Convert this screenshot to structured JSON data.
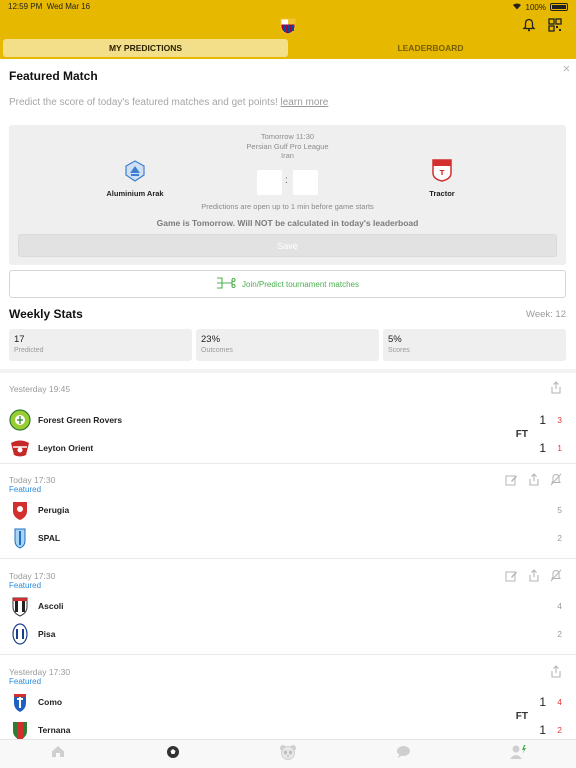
{
  "status": {
    "time": "12:59 PM",
    "date": "Wed Mar 16",
    "battery": "100%"
  },
  "tabs": [
    {
      "label": "MY PREDICTIONS"
    },
    {
      "label": "LEADERBOARD"
    }
  ],
  "featured": {
    "title": "Featured Match",
    "intro": "Predict the score of today's featured matches and get points!",
    "learn_more": "learn more",
    "kickoff": "Tomorrow 11:30",
    "league": "Persian Gulf Pro League",
    "country": "Iran",
    "home": "Aluminium Arak",
    "away": "Tractor",
    "colon": ":",
    "note1": "Predictions are open up to 1 min before game starts",
    "note2": "Game is Tomorrow. Will NOT be calculated in today's leaderboad",
    "save": "Save",
    "join": "Join/Predict tournament matches"
  },
  "weekly": {
    "title": "Weekly Stats",
    "week": "Week: 12",
    "stats": [
      {
        "value": "17",
        "label": "Predicted"
      },
      {
        "value": "23%",
        "label": "Outcomes"
      },
      {
        "value": "5%",
        "label": "Scores"
      }
    ]
  },
  "matches": [
    {
      "time": "Yesterday 19:45",
      "featured": "",
      "status": "FT",
      "home": {
        "name": "Forest Green Rovers",
        "score": "1",
        "pred": "3"
      },
      "away": {
        "name": "Leyton Orient",
        "score": "1",
        "pred": "1"
      }
    },
    {
      "time": "Today 17:30",
      "featured": "Featured",
      "status": "",
      "home": {
        "name": "Perugia",
        "score": "",
        "pred": "5"
      },
      "away": {
        "name": "SPAL",
        "score": "",
        "pred": "2"
      }
    },
    {
      "time": "Today 17:30",
      "featured": "Featured",
      "status": "",
      "home": {
        "name": "Ascoli",
        "score": "",
        "pred": "4"
      },
      "away": {
        "name": "Pisa",
        "score": "",
        "pred": "2"
      }
    },
    {
      "time": "Yesterday 17:30",
      "featured": "Featured",
      "status": "FT",
      "home": {
        "name": "Como",
        "score": "1",
        "pred": "4"
      },
      "away": {
        "name": "Ternana",
        "score": "1",
        "pred": "2"
      }
    }
  ],
  "colors": {
    "brand": "#e6b800",
    "accent_green": "#4caf50",
    "featured_blue": "#2a8be0",
    "pred_red": "#e53935"
  },
  "icons": {
    "bottom": [
      "home-icon",
      "ball-icon",
      "panda-icon",
      "chat-icon",
      "profile-icon"
    ]
  }
}
